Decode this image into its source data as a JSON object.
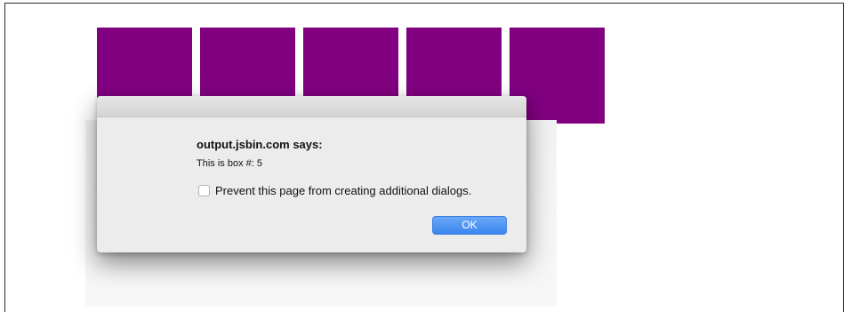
{
  "boxes": {
    "count": 5,
    "color": "#800080"
  },
  "dialog": {
    "title": "output.jsbin.com says:",
    "message": "This is box #: 5",
    "checkbox_label": "Prevent this page from creating additional dialogs.",
    "checkbox_checked": false,
    "ok_label": "OK",
    "ok_color": "#3a86ef"
  }
}
